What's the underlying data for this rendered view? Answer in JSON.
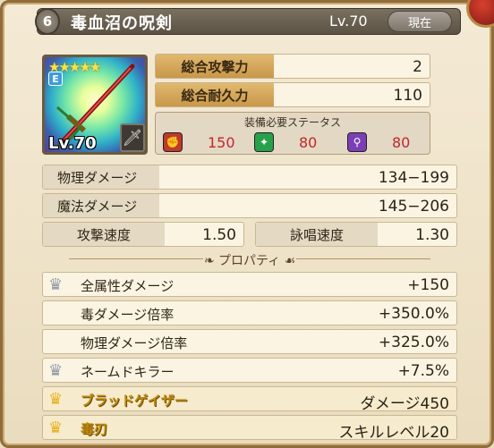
{
  "header": {
    "rarity": "6",
    "item_name": "毒血沼の呪剣",
    "level": "Lv.70",
    "current_label": "現在"
  },
  "weapon": {
    "stars": "★★★★★",
    "element_badge": "E",
    "level": "Lv.70",
    "type_icon": "sword-icon"
  },
  "totals": [
    {
      "label": "総合攻撃力",
      "value": "2"
    },
    {
      "label": "総合耐久力",
      "value": "110"
    }
  ],
  "requirements": {
    "title": "装備必要ステータス",
    "items": [
      {
        "icon": "strength-icon",
        "value": "150",
        "color": "#c0392b"
      },
      {
        "icon": "dexterity-icon",
        "value": "80",
        "color": "#27a14a"
      },
      {
        "icon": "magic-icon",
        "value": "80",
        "color": "#7b3fb5"
      }
    ]
  },
  "damage": [
    {
      "label": "物理ダメージ",
      "value": "134−199"
    },
    {
      "label": "魔法ダメージ",
      "value": "145−206"
    }
  ],
  "speed": [
    {
      "label": "攻撃速度",
      "value": "1.50"
    },
    {
      "label": "詠唱速度",
      "value": "1.30"
    }
  ],
  "properties_title": "プロパティ",
  "properties": [
    {
      "crown": "silver",
      "label": "全属性ダメージ",
      "value": "+150"
    },
    {
      "crown": "none",
      "label": "毒ダメージ倍率",
      "value": "+350.0%"
    },
    {
      "crown": "none",
      "label": "物理ダメージ倍率",
      "value": "+325.0%"
    },
    {
      "crown": "silver",
      "label": "ネームドキラー",
      "value": "+7.5%"
    },
    {
      "crown": "gold",
      "label": "ブラッドゲイザー",
      "value": "ダメージ450"
    },
    {
      "crown": "gold",
      "label": "毒刃",
      "value": "スキルレベル20"
    }
  ],
  "colors": {
    "frame": "#8f6b3e",
    "label_gold": "#c9974a",
    "red_value": "#c1272d"
  }
}
